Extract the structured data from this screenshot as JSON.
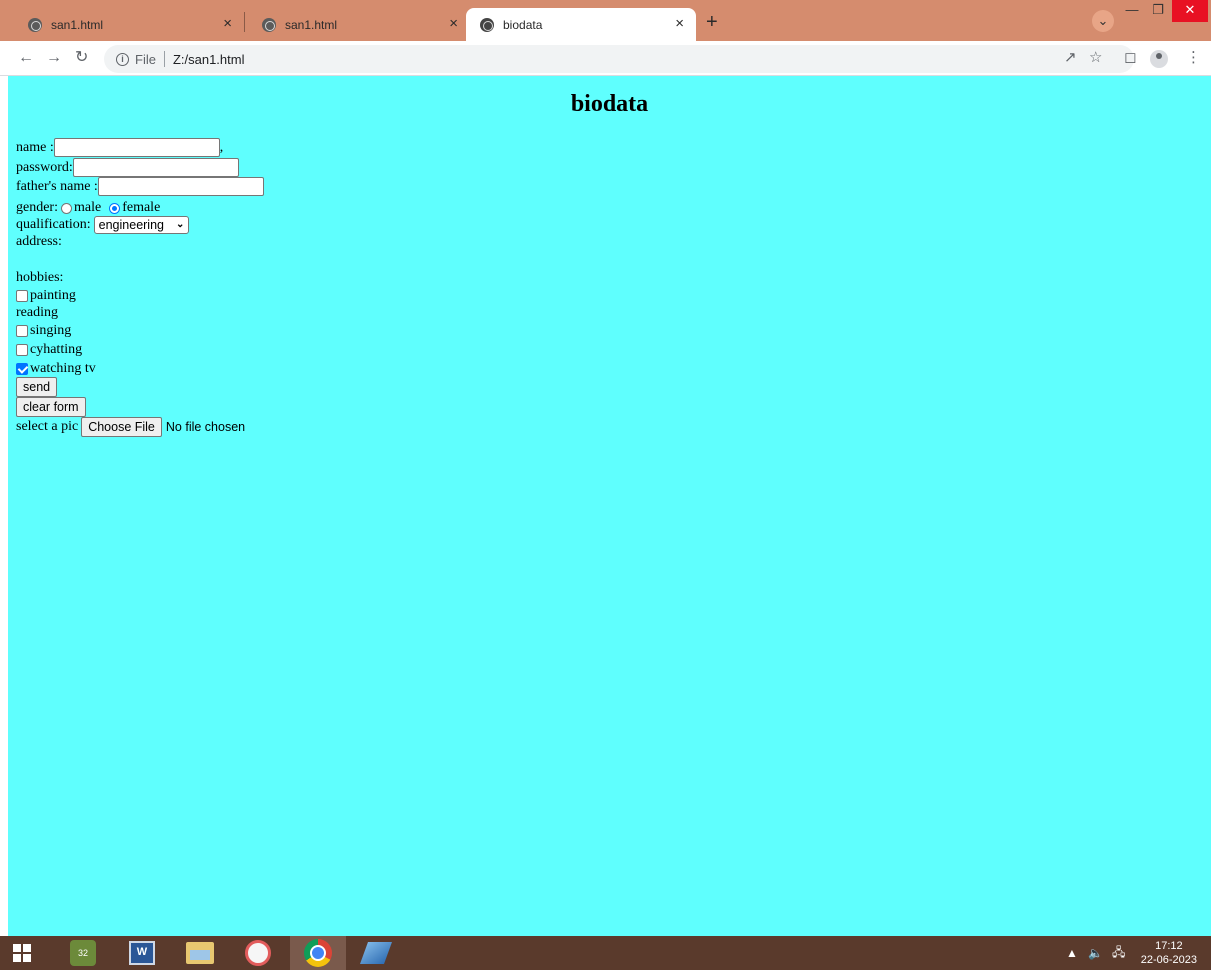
{
  "browser": {
    "tabs": [
      {
        "title": "san1.html",
        "active": false
      },
      {
        "title": "san1.html",
        "active": false
      },
      {
        "title": "biodata",
        "active": true
      }
    ],
    "tab_close_glyph": "×",
    "new_tab_glyph": "+",
    "tab_list_glyph": "⌄",
    "address": {
      "scheme_label": "File",
      "url": "Z:/san1.html"
    }
  },
  "page": {
    "title": "biodata",
    "name_label": "name :",
    "name_value": "",
    "name_trailing": ",",
    "password_label": "password:",
    "password_value": "",
    "father_label": "father's name :",
    "father_value": "",
    "gender_label": "gender:",
    "gender_options": [
      "male",
      "female"
    ],
    "gender_selected": "female",
    "qualification_label": "qualification:",
    "qualification_selected": "engineering",
    "address_label": "address:",
    "hobbies_label": "hobbies:",
    "hobbies": [
      {
        "label": "painting",
        "checkbox": true,
        "checked": false
      },
      {
        "label": "reading",
        "checkbox": false,
        "checked": false
      },
      {
        "label": "singing",
        "checkbox": true,
        "checked": false
      },
      {
        "label": "cyhatting",
        "checkbox": true,
        "checked": false
      },
      {
        "label": "watching tv",
        "checkbox": true,
        "checked": true
      }
    ],
    "send_label": "send",
    "clear_label": "clear form",
    "pic_label": "select a pic",
    "choose_file_label": "Choose File",
    "file_status": "No file chosen"
  },
  "taskbar": {
    "gear_badge": "32",
    "time": "17:12",
    "date": "22-06-2023"
  },
  "colors": {
    "page_background": "#5ffffe",
    "tabstrip": "#d58c6e",
    "taskbar": "#5a3a2c",
    "accent": "#0075ff"
  }
}
